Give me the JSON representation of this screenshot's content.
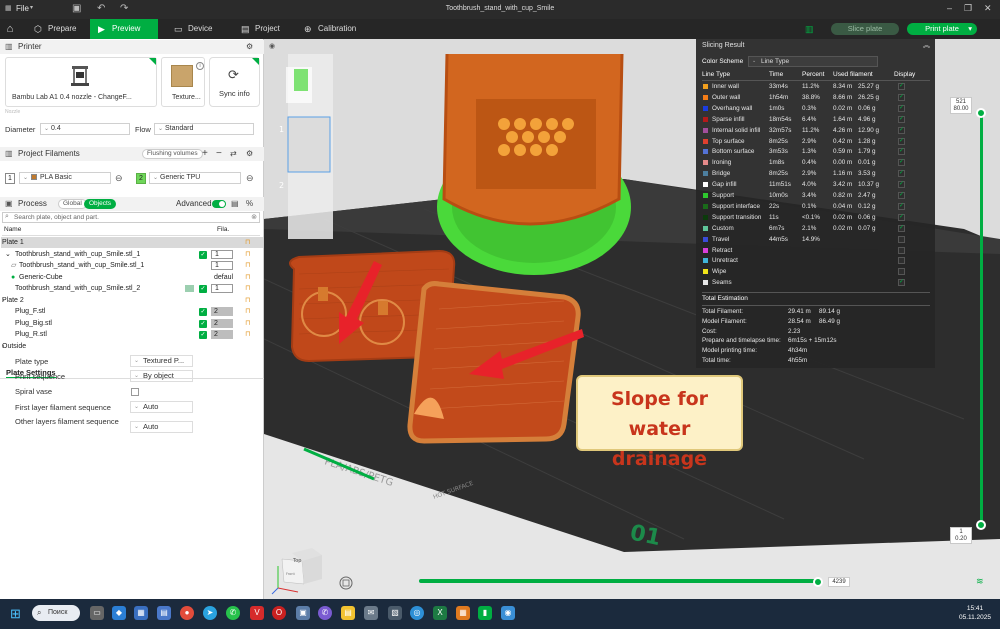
{
  "titlebar": {
    "file_menu": "File",
    "title": "Toothbrush_stand_with_cup_Smile"
  },
  "nav": {
    "tabs": [
      {
        "label": "Prepare",
        "icon": "prepare-icon",
        "active": false
      },
      {
        "label": "Preview",
        "icon": "preview-icon",
        "active": true
      },
      {
        "label": "Device",
        "icon": "device-icon",
        "active": false
      },
      {
        "label": "Project",
        "icon": "project-icon",
        "active": false
      },
      {
        "label": "Calibration",
        "icon": "calibration-icon",
        "active": false
      }
    ],
    "slice_plate": "Slice plate",
    "print_plate": "Print plate"
  },
  "printer": {
    "section_title": "Printer",
    "name": "Bambu Lab A1 0.4 nozzle - ChangeF...",
    "plate_type": "Texture...",
    "sync_info": "Sync info",
    "diameter_label": "Diameter",
    "diameter_value": "0.4",
    "flow_label": "Flow",
    "flow_value": "Standard"
  },
  "filaments": {
    "section_title": "Project Filaments",
    "flushing_volumes": "Flushing volumes",
    "items": [
      {
        "index": "1",
        "name": "PLA Basic",
        "color": "#c07a2e"
      },
      {
        "index": "2",
        "name": "Generic TPU",
        "color": "#6fd65a"
      }
    ]
  },
  "process": {
    "section_title": "Process",
    "global_tab": "Global",
    "objects_tab": "Objects",
    "advanced_label": "Advanced",
    "search_placeholder": "Search plate, object and part.",
    "col_name": "Name",
    "col_fila": "Fila.",
    "tree": [
      {
        "text": "Plate 1",
        "level": 0,
        "selected": true,
        "fil": "",
        "check": false
      },
      {
        "text": "Toothbrush_stand_with_cup_Smile.stl_1",
        "level": 1,
        "fil": "1",
        "check": true,
        "white": true
      },
      {
        "text": "Toothbrush_stand_with_cup_Smile.stl_1",
        "level": 2,
        "fil": "1",
        "check": false,
        "white": true
      },
      {
        "text": "Generic-Cube",
        "level": 2,
        "fil": "defaul",
        "check": false,
        "white": false,
        "plain": true
      },
      {
        "text": "Toothbrush_stand_with_cup_Smile.stl_2",
        "level": 1,
        "fil": "1",
        "check": true,
        "white": true
      },
      {
        "text": "Plate 2",
        "level": 0,
        "fil": "",
        "check": false
      },
      {
        "text": "Plug_F.stl",
        "level": 1,
        "fil": "2",
        "check": true
      },
      {
        "text": "Plug_Big.stl",
        "level": 1,
        "fil": "2",
        "check": true
      },
      {
        "text": "Plug_R.stl",
        "level": 1,
        "fil": "2",
        "check": true
      },
      {
        "text": "Outside",
        "level": 0,
        "fil": "",
        "check": false
      }
    ]
  },
  "plate_settings": {
    "title": "Plate Settings",
    "rows": [
      {
        "label": "Plate type",
        "value": "Textured P...",
        "kind": "combo"
      },
      {
        "label": "Print sequence",
        "value": "By object",
        "kind": "combo"
      },
      {
        "label": "Spiral vase",
        "value": "",
        "kind": "checkbox"
      },
      {
        "label": "First layer filament sequence",
        "value": "Auto",
        "kind": "combo"
      },
      {
        "label": "Other layers filament sequence",
        "value": "Auto",
        "kind": "combo"
      }
    ]
  },
  "viewport": {
    "plate_numbers": [
      "1",
      "2"
    ],
    "plate_label": "01",
    "bed_text": "PLA/ABS/PETG",
    "bed_text2": "HOT SURFACE",
    "cube_label": "Top",
    "cube_label2": "Front"
  },
  "slicing": {
    "title": "Slicing Result",
    "color_scheme_label": "Color Scheme",
    "color_scheme_value": "Line Type",
    "headers": [
      "Line Type",
      "Time",
      "Percent",
      "Used filament",
      "Display"
    ],
    "rows": [
      {
        "name": "Inner wall",
        "color": "#f2a01e",
        "time": "33m4s",
        "percent": "11.2%",
        "length": "8.34 m",
        "weight": "25.27 g",
        "display": true
      },
      {
        "name": "Outer wall",
        "color": "#f57d17",
        "time": "1h54m",
        "percent": "38.8%",
        "length": "8.66 m",
        "weight": "26.25 g",
        "display": true
      },
      {
        "name": "Overhang wall",
        "color": "#1b3ce0",
        "time": "1m0s",
        "percent": "0.3%",
        "length": "0.02 m",
        "weight": "0.06 g",
        "display": true
      },
      {
        "name": "Sparse infill",
        "color": "#b31a1a",
        "time": "18m54s",
        "percent": "6.4%",
        "length": "1.64 m",
        "weight": "4.96 g",
        "display": true
      },
      {
        "name": "Internal solid infill",
        "color": "#a14f9c",
        "time": "32m57s",
        "percent": "11.2%",
        "length": "4.26 m",
        "weight": "12.90 g",
        "display": true
      },
      {
        "name": "Top surface",
        "color": "#e0402f",
        "time": "8m25s",
        "percent": "2.9%",
        "length": "0.42 m",
        "weight": "1.28 g",
        "display": true
      },
      {
        "name": "Bottom surface",
        "color": "#5473d6",
        "time": "3m53s",
        "percent": "1.3%",
        "length": "0.59 m",
        "weight": "1.79 g",
        "display": true
      },
      {
        "name": "Ironing",
        "color": "#e58a8a",
        "time": "1m8s",
        "percent": "0.4%",
        "length": "0.00 m",
        "weight": "0.01 g",
        "display": true
      },
      {
        "name": "Bridge",
        "color": "#4d7f9f",
        "time": "8m25s",
        "percent": "2.9%",
        "length": "1.16 m",
        "weight": "3.53 g",
        "display": true
      },
      {
        "name": "Gap infill",
        "color": "#ffffff",
        "time": "11m51s",
        "percent": "4.0%",
        "length": "3.42 m",
        "weight": "10.37 g",
        "display": true
      },
      {
        "name": "Support",
        "color": "#2ec72e",
        "time": "10m0s",
        "percent": "3.4%",
        "length": "0.82 m",
        "weight": "2.47 g",
        "display": true
      },
      {
        "name": "Support interface",
        "color": "#1a6b1a",
        "time": "22s",
        "percent": "0.1%",
        "length": "0.04 m",
        "weight": "0.12 g",
        "display": true
      },
      {
        "name": "Support transition",
        "color": "#0b3a0b",
        "time": "11s",
        "percent": "<0.1%",
        "length": "0.02 m",
        "weight": "0.06 g",
        "display": true
      },
      {
        "name": "Custom",
        "color": "#5fc49a",
        "time": "6m7s",
        "percent": "2.1%",
        "length": "0.02 m",
        "weight": "0.07 g",
        "display": true
      },
      {
        "name": "Travel",
        "color": "#3a4cd8",
        "time": "44m5s",
        "percent": "14.9%",
        "length": "",
        "weight": "",
        "display": false
      },
      {
        "name": "Retract",
        "color": "#d93fd9",
        "time": "",
        "percent": "",
        "length": "",
        "weight": "",
        "display": false
      },
      {
        "name": "Unretract",
        "color": "#3fb5d9",
        "time": "",
        "percent": "",
        "length": "",
        "weight": "",
        "display": false
      },
      {
        "name": "Wipe",
        "color": "#f2e51a",
        "time": "",
        "percent": "",
        "length": "",
        "weight": "",
        "display": false
      },
      {
        "name": "Seams",
        "color": "#e6e6e6",
        "time": "",
        "percent": "",
        "length": "",
        "weight": "",
        "display": true
      }
    ],
    "total_title": "Total Estimation",
    "totals": [
      {
        "label": "Total Filament:",
        "v1": "29.41 m",
        "v2": "89.14 g"
      },
      {
        "label": "Model Filament:",
        "v1": "28.54 m",
        "v2": "86.49 g"
      },
      {
        "label": "Cost:",
        "v1": "2.23",
        "v2": ""
      },
      {
        "label": "Prepare and timelapse time:",
        "v1": "6m15s + 15m12s",
        "v2": ""
      },
      {
        "label": "Model printing time:",
        "v1": "4h34m",
        "v2": ""
      },
      {
        "label": "Total time:",
        "v1": "4h55m",
        "v2": ""
      }
    ]
  },
  "annotation": {
    "line1": "Slope for water",
    "line2": "drainage"
  },
  "layer_slider": {
    "top_layer": "521",
    "top_height": "80.00",
    "bottom_layer": "1",
    "bottom_height": "0.20"
  },
  "move_slider": {
    "value": "4239",
    "fraction": 1.0
  },
  "taskbar": {
    "search_label": "Поиск",
    "time": "15:41",
    "date": "05.11.2025"
  }
}
